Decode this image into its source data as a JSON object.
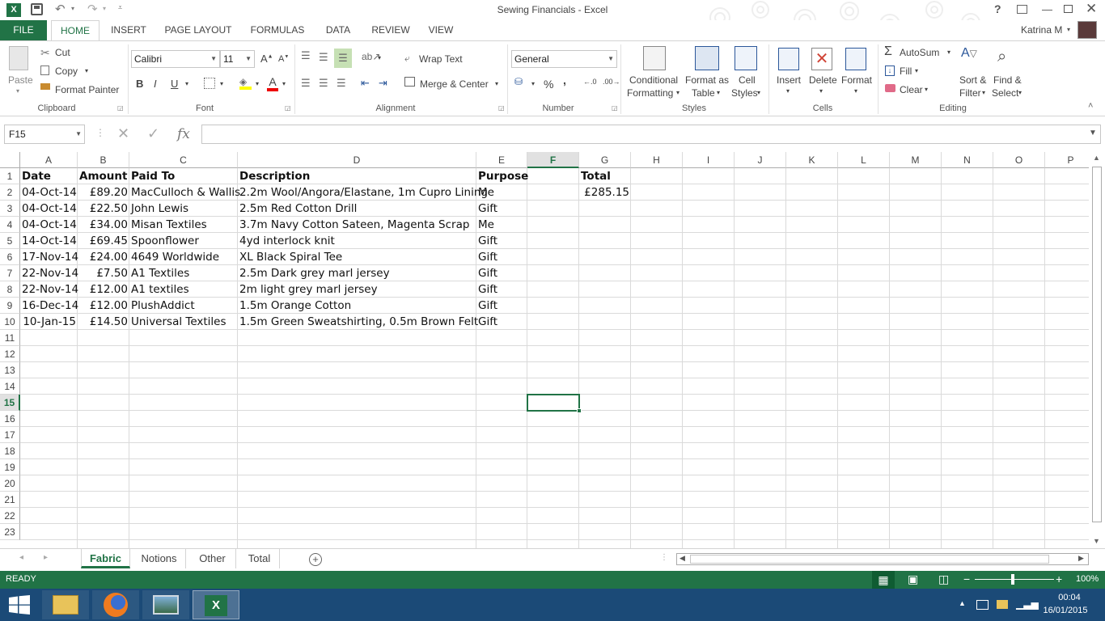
{
  "window": {
    "title": "Sewing Financials - Excel",
    "help": "?",
    "user": "Katrina M"
  },
  "ribbon_tabs": [
    "FILE",
    "HOME",
    "INSERT",
    "PAGE LAYOUT",
    "FORMULAS",
    "DATA",
    "REVIEW",
    "VIEW"
  ],
  "clipboard": {
    "paste": "Paste",
    "cut": "Cut",
    "copy": "Copy",
    "format_painter": "Format Painter",
    "label": "Clipboard"
  },
  "font": {
    "name": "Calibri",
    "size": "11",
    "bold": "B",
    "italic": "I",
    "underline": "U",
    "label": "Font"
  },
  "alignment": {
    "wrap": "Wrap Text",
    "merge": "Merge & Center",
    "label": "Alignment"
  },
  "number": {
    "format": "General",
    "percent": "%",
    "comma": ",",
    "label": "Number"
  },
  "styles": {
    "conditional": "Conditional",
    "conditional2": "Formatting",
    "format_as": "Format as",
    "format_as2": "Table",
    "cell": "Cell",
    "cell2": "Styles",
    "label": "Styles"
  },
  "cells": {
    "insert": "Insert",
    "delete": "Delete",
    "format": "Format",
    "label": "Cells"
  },
  "editing": {
    "autosum": "AutoSum",
    "fill": "Fill",
    "clear": "Clear",
    "sort": "Sort &",
    "sort2": "Filter",
    "find": "Find &",
    "find2": "Select",
    "label": "Editing"
  },
  "formula_bar": {
    "name_box": "F15",
    "fx": "fx",
    "content": ""
  },
  "columns": [
    "A",
    "B",
    "C",
    "D",
    "E",
    "F",
    "G",
    "H",
    "I",
    "J",
    "K",
    "L",
    "M",
    "N",
    "O",
    "P"
  ],
  "rows": [
    "1",
    "2",
    "3",
    "4",
    "5",
    "6",
    "7",
    "8",
    "9",
    "10",
    "11",
    "12",
    "13",
    "14",
    "15",
    "16",
    "17",
    "18",
    "19",
    "20",
    "21",
    "22",
    "23"
  ],
  "headers": {
    "date": "Date",
    "amount": "Amount",
    "paid_to": "Paid To",
    "description": "Description",
    "purpose": "Purpose",
    "total": "Total"
  },
  "total_value": "£285.15",
  "data_rows": [
    {
      "date": "04-Oct-14",
      "amount": "£89.20",
      "paid_to": "MacCulloch & Wallis",
      "description": "2.2m Wool/Angora/Elastane, 1m Cupro Lining",
      "purpose": "Me"
    },
    {
      "date": "04-Oct-14",
      "amount": "£22.50",
      "paid_to": "John Lewis",
      "description": "2.5m Red Cotton Drill",
      "purpose": "Gift"
    },
    {
      "date": "04-Oct-14",
      "amount": "£34.00",
      "paid_to": "Misan Textiles",
      "description": "3.7m Navy Cotton Sateen, Magenta Scrap",
      "purpose": "Me"
    },
    {
      "date": "14-Oct-14",
      "amount": "£69.45",
      "paid_to": "Spoonflower",
      "description": "4yd interlock knit",
      "purpose": "Gift"
    },
    {
      "date": "17-Nov-14",
      "amount": "£24.00",
      "paid_to": "4649 Worldwide",
      "description": "XL Black Spiral Tee",
      "purpose": "Gift"
    },
    {
      "date": "22-Nov-14",
      "amount": "£7.50",
      "paid_to": "A1 Textiles",
      "description": "2.5m Dark grey marl jersey",
      "purpose": "Gift"
    },
    {
      "date": "22-Nov-14",
      "amount": "£12.00",
      "paid_to": "A1 textiles",
      "description": "2m light grey marl jersey",
      "purpose": "Gift"
    },
    {
      "date": "16-Dec-14",
      "amount": "£12.00",
      "paid_to": "PlushAddict",
      "description": "1.5m Orange Cotton",
      "purpose": "Gift"
    },
    {
      "date": "10-Jan-15",
      "amount": "£14.50",
      "paid_to": "Universal Textiles",
      "description": "1.5m Green Sweatshirting, 0.5m Brown Felt",
      "purpose": "Gift"
    }
  ],
  "sheets": [
    "Fabric",
    "Notions",
    "Other",
    "Total"
  ],
  "active_sheet": "Fabric",
  "status": {
    "mode": "READY",
    "zoom": "100%"
  },
  "taskbar": {
    "time": "00:04",
    "date": "16/01/2015"
  },
  "colors": {
    "excel_green": "#217346",
    "taskbar": "#1b4a77",
    "selection": "#217346"
  }
}
